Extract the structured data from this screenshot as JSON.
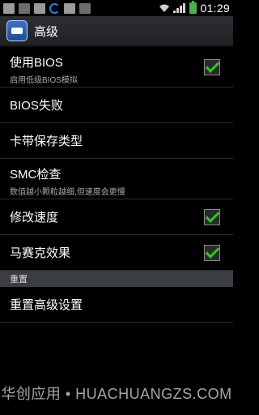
{
  "status_bar": {
    "time": "01:29",
    "icons": [
      "gallery-icon",
      "flag-icon",
      "gallery-icon",
      "sync-icon",
      "gallery-icon",
      "sd-card-icon",
      "wifi-icon",
      "signal-icon",
      "battery-icon"
    ]
  },
  "action_bar": {
    "title": "高级",
    "icon": "app-icon"
  },
  "preferences": [
    {
      "title": "使用BIOS",
      "summary": "启用低级BIOS模拟",
      "checked": true
    },
    {
      "title": "BIOS失败",
      "summary": "",
      "checked": null
    },
    {
      "title": "卡带保存类型",
      "summary": "",
      "checked": null
    },
    {
      "title": "SMC检查",
      "summary": "数值越小颗粒越细,但速度会更慢",
      "checked": null
    },
    {
      "title": "修改速度",
      "summary": "",
      "checked": true
    },
    {
      "title": "马赛克效果",
      "summary": "",
      "checked": true
    }
  ],
  "category": {
    "label": "重置"
  },
  "reset_item": {
    "title": "重置高级设置"
  },
  "watermark": "华创应用 • HUACHUANGZS.COM",
  "colors": {
    "check_green": "#34c42a",
    "actionbar": "#2c2f33",
    "category_bg": "#3a3d42"
  }
}
